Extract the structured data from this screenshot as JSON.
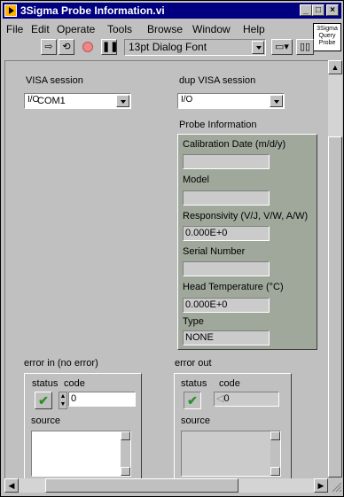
{
  "window": {
    "title": "3Sigma Probe Information.vi",
    "controls": {
      "minimize": "_",
      "maximize": "□",
      "close": "×"
    }
  },
  "menu": [
    "File",
    "Edit",
    "Operate",
    "Tools",
    "Browse",
    "Window",
    "Help"
  ],
  "toolbar": {
    "font": "13pt Dialog Font",
    "icons": [
      "run-arrow-icon",
      "run-continuously-icon",
      "abort-stop-icon",
      "pause-icon",
      "font-dropdown-icon",
      "align-icon",
      "distribute-icon"
    ]
  },
  "vi_icon_text": [
    "3Sigma",
    "Query",
    "Probe"
  ],
  "visa": {
    "label": "VISA session",
    "value": "COM1",
    "icon": "I/O"
  },
  "dup_visa": {
    "label": "dup VISA session",
    "value": "",
    "icon": "I/O"
  },
  "probe_info": {
    "label": "Probe Information",
    "fields": [
      {
        "label": "Calibration Date (m/d/y)",
        "value": ""
      },
      {
        "label": "Model",
        "value": ""
      },
      {
        "label": "Responsivity (V/J, V/W, A/W)",
        "value": "0.000E+0"
      },
      {
        "label": "Serial Number",
        "value": ""
      },
      {
        "label": "Head Temperature (°C)",
        "value": "0.000E+0"
      },
      {
        "label": "Type",
        "value": "NONE"
      }
    ]
  },
  "error_in": {
    "label": "error in (no error)",
    "status_label": "status",
    "code_label": "code",
    "code_value": "0",
    "source_label": "source",
    "source_value": ""
  },
  "error_out": {
    "label": "error out",
    "status_label": "status",
    "code_label": "code",
    "code_value": "0",
    "source_label": "source",
    "source_value": ""
  },
  "colors": {
    "title_bar": "#000080",
    "panel": "#c0c0c0",
    "cluster": "#a0a89c",
    "indicator": "#cbcbcb",
    "status_ok": "#2a8f2a"
  }
}
